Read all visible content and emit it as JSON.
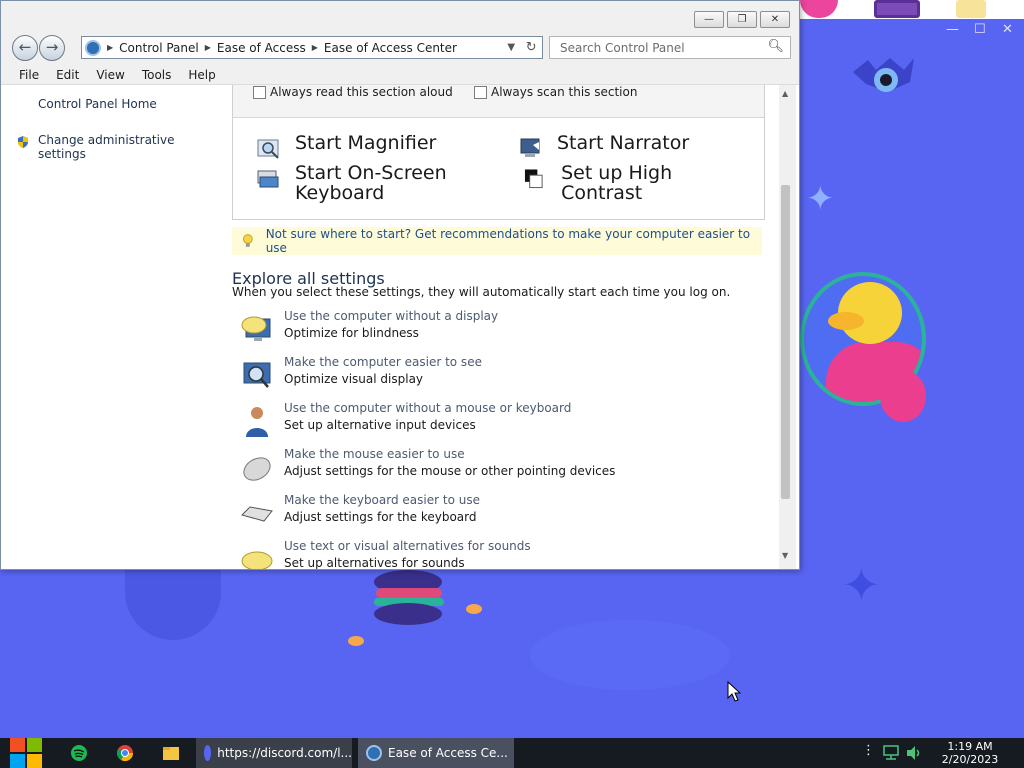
{
  "window": {
    "minimize_label": "—",
    "maximize_label": "❐",
    "close_label": "✕"
  },
  "nav": {
    "back_label": "←",
    "forward_label": "→"
  },
  "address": {
    "crumbs": [
      "Control Panel",
      "Ease of Access",
      "Ease of Access Center"
    ]
  },
  "search": {
    "placeholder": "Search Control Panel"
  },
  "menu": {
    "items": [
      "File",
      "Edit",
      "View",
      "Tools",
      "Help"
    ]
  },
  "sidebar": {
    "links": [
      "Control Panel Home",
      "Change administrative settings"
    ]
  },
  "quick_access": {
    "checkboxes": [
      "Always read this section aloud",
      "Always scan this section"
    ],
    "tools": [
      "Start Magnifier",
      "Start Narrator",
      "Start On-Screen Keyboard",
      "Set up High Contrast"
    ]
  },
  "hint": {
    "text": "Not sure where to start? Get recommendations to make your computer easier to use"
  },
  "explore": {
    "title": "Explore all settings",
    "subtitle": "When you select these settings, they will automatically start each time you log on.",
    "settings": [
      {
        "title": "Use the computer without a display",
        "subtitle": "Optimize for blindness"
      },
      {
        "title": "Make the computer easier to see",
        "subtitle": "Optimize visual display"
      },
      {
        "title": "Use the computer without a mouse or keyboard",
        "subtitle": "Set up alternative input devices"
      },
      {
        "title": "Make the mouse easier to use",
        "subtitle": "Adjust settings for the mouse or other pointing devices"
      },
      {
        "title": "Make the keyboard easier to use",
        "subtitle": "Adjust settings for the keyboard"
      },
      {
        "title": "Use text or visual alternatives for sounds",
        "subtitle": "Set up alternatives for sounds"
      }
    ]
  },
  "discord_window": {
    "minimize_label": "—",
    "maximize_label": "☐",
    "close_label": "✕"
  },
  "taskbar": {
    "tasks": [
      "https://discord.com/l...",
      "Ease of Access Ce..."
    ],
    "time": "1:19 AM",
    "date": "2/20/2023"
  },
  "colors": {
    "discord_bg": "#5865f2",
    "taskbar_bg": "#161b22",
    "hint_bg": "#fdfbd8",
    "hint_text": "#1f4f8f"
  }
}
